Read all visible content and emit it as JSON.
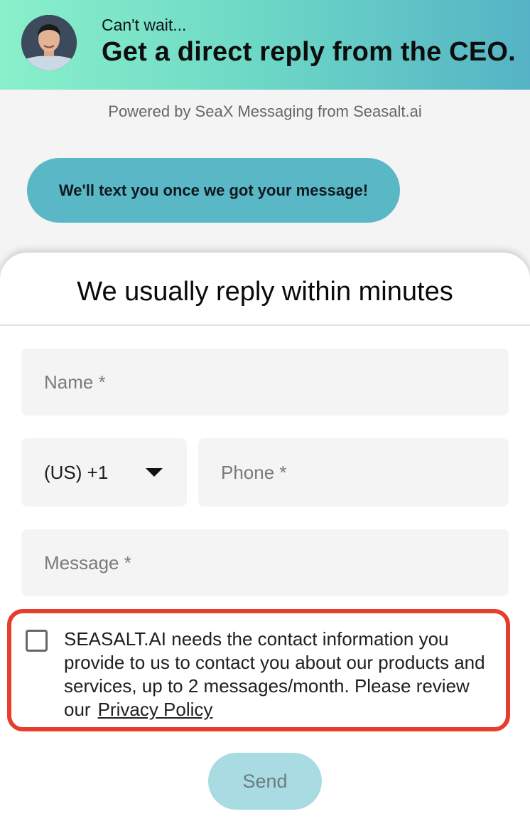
{
  "header": {
    "subtitle": "Can't wait...",
    "title": "Get a direct reply from the CEO.",
    "gradient_start": "#8af0cb",
    "gradient_end": "#55b3c5"
  },
  "powered_by": "Powered by SeaX Messaging from Seasalt.ai",
  "bubble": {
    "text": "We'll text you once we got your message!",
    "color": "#5ab7c5"
  },
  "form": {
    "title": "We usually reply within minutes",
    "name_placeholder": "Name *",
    "country_code": "(US) +1",
    "phone_placeholder": "Phone *",
    "message_placeholder": "Message *",
    "consent_text": "SEASALT.AI needs the contact information you provide to us to contact you about our products and services, up to 2 messages/month. Please review our",
    "privacy_link": "Privacy Policy",
    "consent_checked": false,
    "highlight_color": "#e63d2c",
    "send_label": "Send",
    "send_color": "#a9dce2"
  }
}
